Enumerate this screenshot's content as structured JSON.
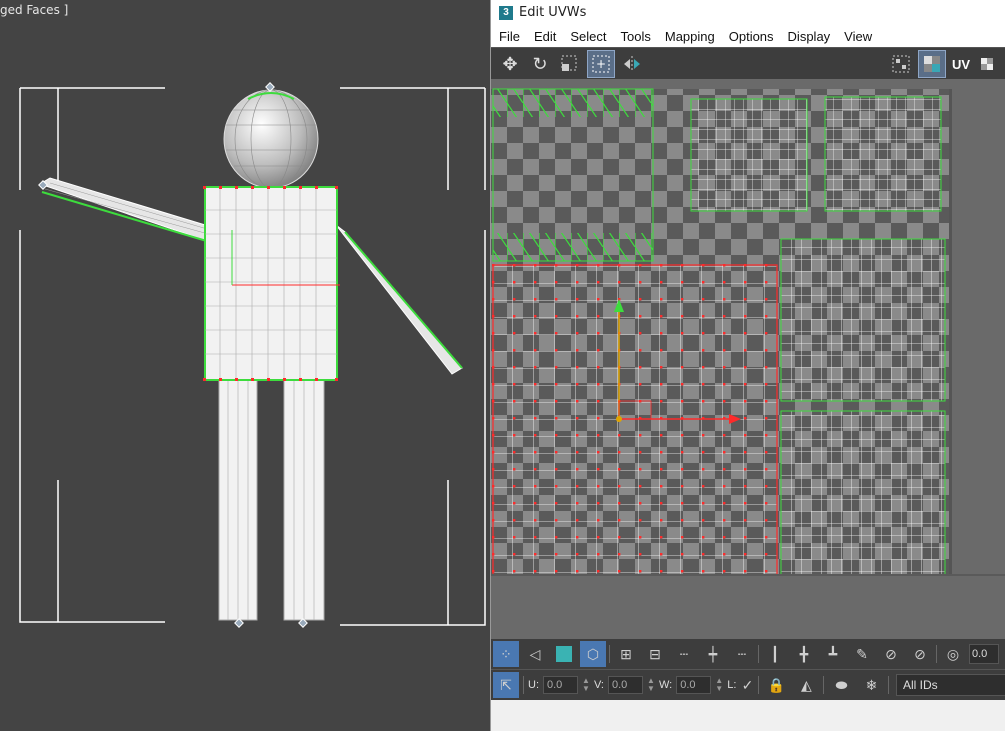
{
  "viewport": {
    "label": "ged Faces ]"
  },
  "window": {
    "title": "Edit UVWs",
    "app_icon": "3"
  },
  "menu": [
    "File",
    "Edit",
    "Select",
    "Tools",
    "Mapping",
    "Options",
    "Display",
    "View"
  ],
  "toolbar": {
    "uv_label": "UV"
  },
  "bottom": {
    "u_label": "U:",
    "u_value": "0.0",
    "v_label": "V:",
    "v_value": "0.0",
    "w_label": "W:",
    "w_value": "0.0",
    "l_label": "L:",
    "ids_label": "All IDs",
    "zoom_value": "0.0"
  },
  "colors": {
    "selection": "#ff2a2a",
    "open_edge": "#3ddc3d",
    "active_tool": "#4a78b2"
  }
}
